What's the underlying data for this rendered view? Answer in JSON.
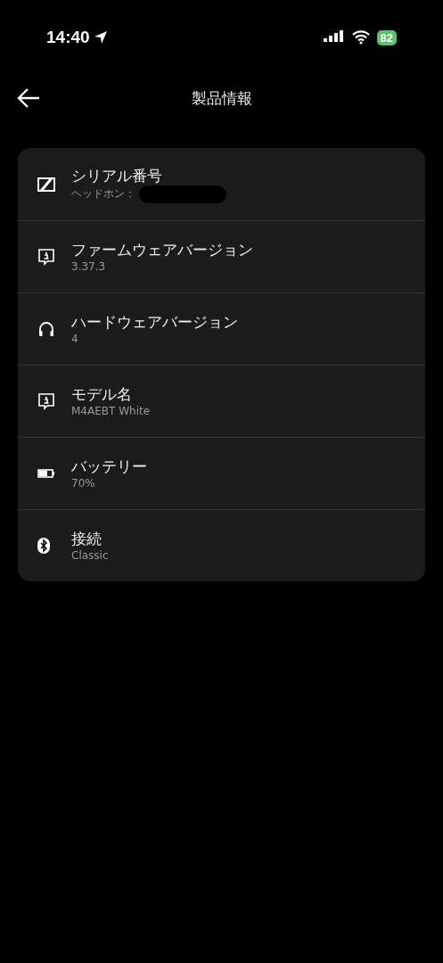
{
  "status_bar": {
    "time": "14:40",
    "battery": "82"
  },
  "header": {
    "title": "製品情報"
  },
  "items": [
    {
      "kind": "brand",
      "label": "シリアル番号",
      "value": "ヘッドホン：",
      "redacted": true
    },
    {
      "kind": "info",
      "label": "ファームウェアバージョン",
      "value": "3.37.3",
      "redacted": false
    },
    {
      "kind": "headphones",
      "label": "ハードウェアバージョン",
      "value": "4",
      "redacted": false
    },
    {
      "kind": "info",
      "label": "モデル名",
      "value": "M4AEBT White",
      "redacted": false
    },
    {
      "kind": "battery",
      "label": "バッテリー",
      "value": "70%",
      "redacted": false
    },
    {
      "kind": "bluetooth",
      "label": "接続",
      "value": "Classic",
      "redacted": false
    }
  ]
}
